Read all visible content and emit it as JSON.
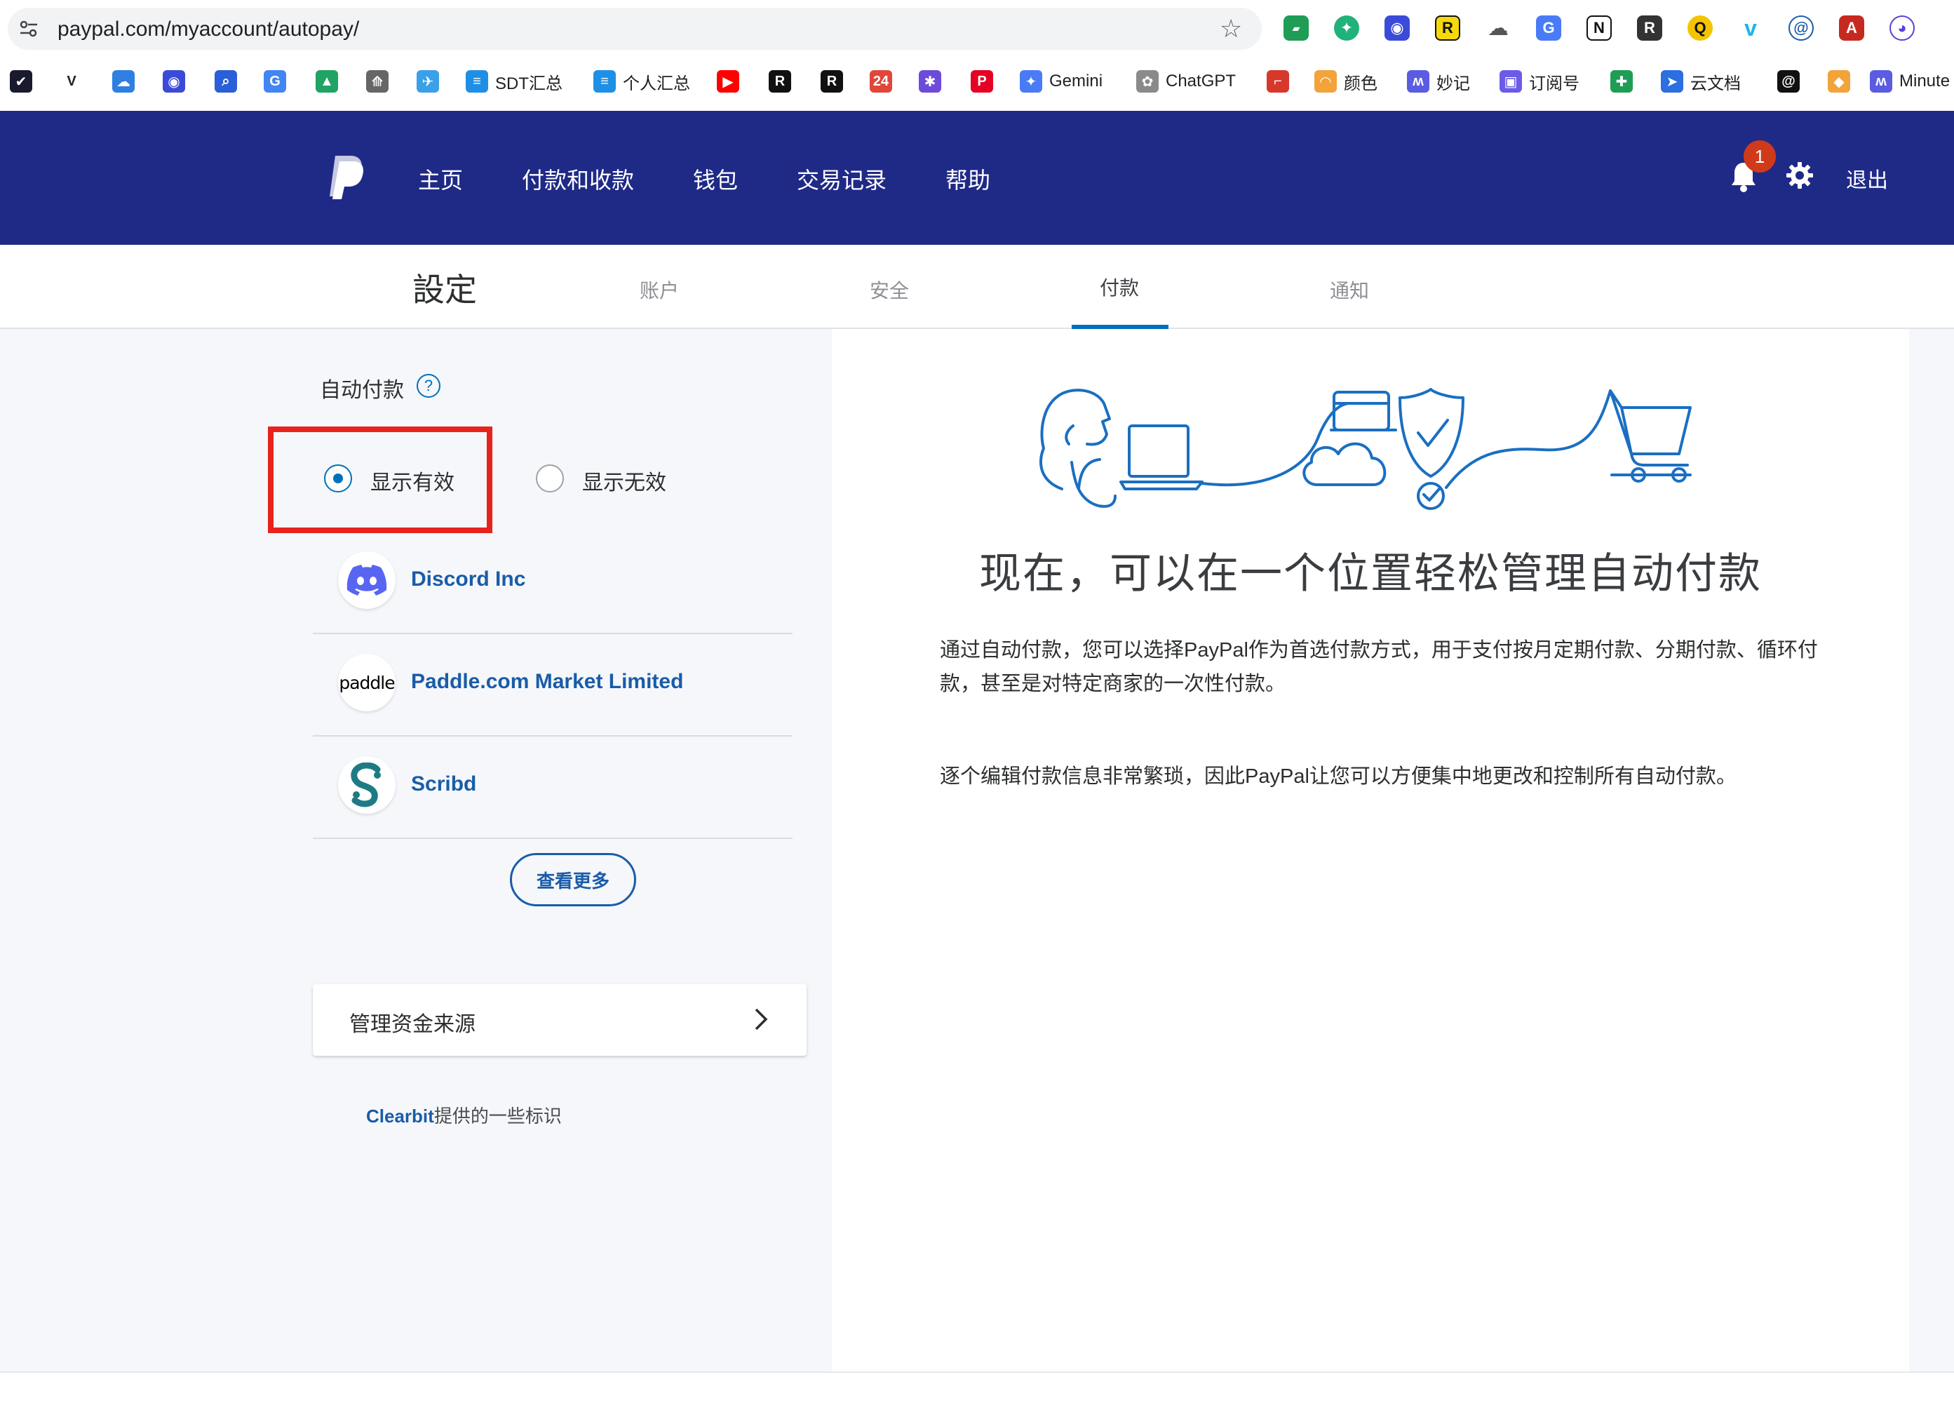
{
  "browser": {
    "url": "paypal.com/myaccount/autopay/",
    "bookmarks": [
      {
        "label": "",
        "icon": "vmark-icon",
        "color": "#1a1a2e"
      },
      {
        "label": "",
        "icon": "v-icon",
        "color": "#ffffff"
      },
      {
        "label": "",
        "icon": "cloud-icon",
        "color": "#2f7fe0"
      },
      {
        "label": "",
        "icon": "bot-icon",
        "color": "#3b4bd8"
      },
      {
        "label": "",
        "icon": "search-icon",
        "color": "#2b5fd9"
      },
      {
        "label": "",
        "icon": "google-icon",
        "color": "#4285f4"
      },
      {
        "label": "",
        "icon": "drive-icon",
        "color": "#1fa463"
      },
      {
        "label": "",
        "icon": "peak-icon",
        "color": "#666666"
      },
      {
        "label": "",
        "icon": "bird-icon",
        "color": "#3aa0e8"
      },
      {
        "label": "SDT汇总",
        "icon": "doc-icon",
        "color": "#1f8fe5"
      },
      {
        "label": "个人汇总",
        "icon": "doc-icon",
        "color": "#1f8fe5"
      },
      {
        "label": "",
        "icon": "youtube-icon",
        "color": "#ff0000"
      },
      {
        "label": "",
        "icon": "r-icon",
        "color": "#111111"
      },
      {
        "label": "",
        "icon": "r-outline-icon",
        "color": "#111111"
      },
      {
        "label": "",
        "icon": "badge24-icon",
        "color": "#e0463a"
      },
      {
        "label": "",
        "icon": "nodes-icon",
        "color": "#6c4bd8"
      },
      {
        "label": "",
        "icon": "pinterest-icon",
        "color": "#e60023"
      },
      {
        "label": "Gemini",
        "icon": "gemini-icon",
        "color": "#4a7bf7"
      },
      {
        "label": "ChatGPT",
        "icon": "chatgpt-icon",
        "color": "#8a8a8a"
      },
      {
        "label": "",
        "icon": "bracket-icon",
        "color": "#d6392b"
      },
      {
        "label": "颜色",
        "icon": "rainbow-icon",
        "color": "#f2a33a"
      },
      {
        "label": "妙记",
        "icon": "wave-icon",
        "color": "#5b5ce2"
      },
      {
        "label": "订阅号",
        "icon": "square-icon",
        "color": "#6b5ce7"
      },
      {
        "label": "",
        "icon": "plus-icon",
        "color": "#1f9d55"
      },
      {
        "label": "云文档",
        "icon": "lark-icon",
        "color": "#2b6fe0"
      },
      {
        "label": "",
        "icon": "threads-icon",
        "color": "#111111"
      },
      {
        "label": "",
        "icon": "box-icon",
        "color": "#f2a33a"
      },
      {
        "label": "Minute",
        "icon": "wave-icon",
        "color": "#5b5ce2"
      }
    ]
  },
  "header": {
    "nav": [
      "主页",
      "付款和收款",
      "钱包",
      "交易记录",
      "帮助"
    ],
    "notification_count": "1",
    "logout": "退出"
  },
  "subnav": {
    "title": "設定",
    "tabs": [
      "账户",
      "安全",
      "付款",
      "通知"
    ],
    "active_tab": "付款"
  },
  "autopay": {
    "section_title": "自动付款",
    "help_symbol": "?",
    "filter_active": "显示有效",
    "filter_inactive": "显示无效",
    "merchants": [
      {
        "name": "Discord Inc",
        "logo": "discord-logo",
        "logo_color": "#5865f2"
      },
      {
        "name": "Paddle.com Market Limited",
        "logo": "paddle-logo",
        "logo_text": "paddle",
        "logo_color": "#000000"
      },
      {
        "name": "Scribd",
        "logo": "scribd-logo",
        "logo_color": "#1e7b85"
      }
    ],
    "see_more": "查看更多",
    "manage_funding": "管理资金来源",
    "clearbit_link": "Clearbit",
    "clearbit_suffix": "提供的一些标识"
  },
  "promo": {
    "headline": "现在，可以在一个位置轻松管理自动付款",
    "paragraph1": "通过自动付款，您可以选择PayPal作为首选付款方式，用于支付按月定期付款、分期付款、循环付款，甚至是对特定商家的一次性付款。",
    "paragraph2": "逐个编辑付款信息非常繁琐，因此PayPal让您可以方便集中地更改和控制所有自动付款。"
  },
  "colors": {
    "header_bg": "#1f2a87",
    "link_blue": "#1a5ca8",
    "accent": "#0070ba",
    "highlight_red": "#e8231c"
  }
}
